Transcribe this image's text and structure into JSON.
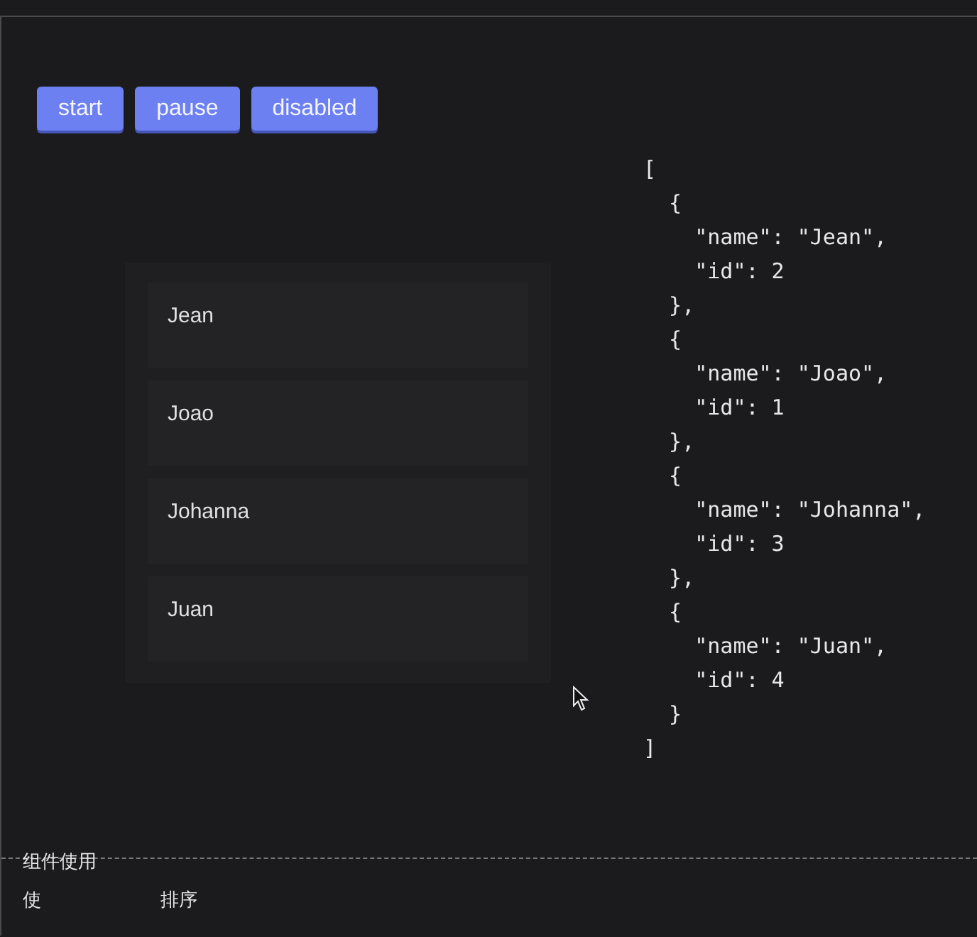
{
  "buttons": [
    {
      "label": "start"
    },
    {
      "label": "pause"
    },
    {
      "label": "disabled"
    }
  ],
  "list": {
    "items": [
      {
        "label": "Jean"
      },
      {
        "label": "Joao"
      },
      {
        "label": "Johanna"
      },
      {
        "label": "Juan"
      }
    ]
  },
  "code": "[\n  {\n    \"name\": \"Jean\",\n    \"id\": 2\n  },\n  {\n    \"name\": \"Joao\",\n    \"id\": 1\n  },\n  {\n    \"name\": \"Johanna\",\n    \"id\": 3\n  },\n  {\n    \"name\": \"Juan\",\n    \"id\": 4\n  }\n]",
  "section": {
    "title": "组件使用",
    "description_parts": [
      "使",
      "排序"
    ]
  }
}
